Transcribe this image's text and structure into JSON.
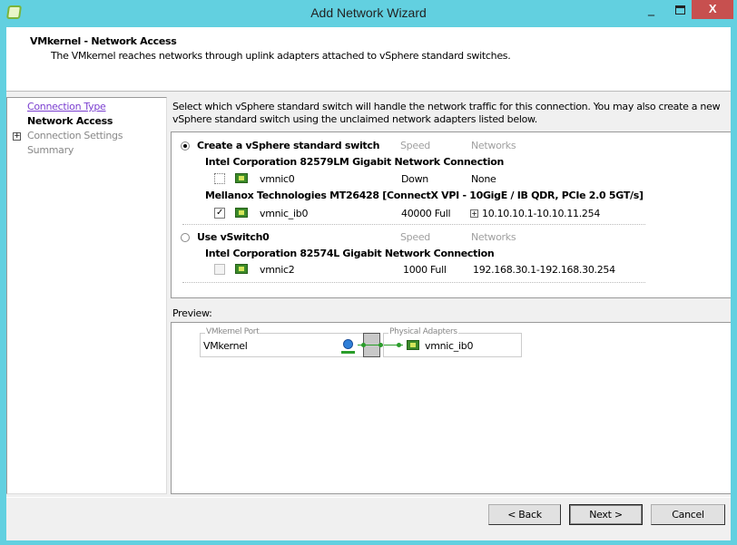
{
  "window": {
    "title": "Add Network Wizard",
    "minimize": "_",
    "close": "X"
  },
  "header": {
    "title": "VMkernel - Network Access",
    "subtitle": "The VMkernel reaches networks through uplink adapters attached to vSphere standard switches."
  },
  "nav": {
    "items": [
      {
        "label": "Connection Type"
      },
      {
        "label": "Network Access"
      },
      {
        "label": "Connection Settings"
      },
      {
        "label": "Summary"
      }
    ],
    "expand": "+"
  },
  "instruction": "Select which vSphere standard switch will handle the network traffic for this connection. You may also create a new vSphere standard switch using the unclaimed network adapters listed below.",
  "options": {
    "create": {
      "label": "Create a vSphere standard switch",
      "speed_header": "Speed",
      "networks_header": "Networks",
      "groups": [
        {
          "name": "Intel Corporation 82579LM Gigabit Network Connection",
          "adapter": {
            "name": "vmnic0",
            "speed": "Down",
            "networks": "None",
            "checked": false
          }
        },
        {
          "name": "Mellanox Technologies MT26428 [ConnectX VPI - 10GigE / IB QDR, PCIe 2.0 5GT/s]",
          "adapter": {
            "name": "vmnic_ib0",
            "speed": "40000 Full",
            "networks": "10.10.10.1-10.10.11.254",
            "checked": true,
            "check": "✓",
            "expand": "+"
          }
        }
      ]
    },
    "existing": {
      "label": "Use vSwitch0",
      "speed_header": "Speed",
      "networks_header": "Networks",
      "groups": [
        {
          "name": "Intel Corporation 82574L Gigabit Network Connection",
          "adapter": {
            "name": "vmnic2",
            "speed": "1000 Full",
            "networks": "192.168.30.1-192.168.30.254",
            "checked": false
          }
        }
      ]
    }
  },
  "preview": {
    "label": "Preview:",
    "port_legend": "VMkernel Port",
    "port_name": "VMkernel",
    "adapters_legend": "Physical Adapters",
    "adapter": "vmnic_ib0"
  },
  "buttons": {
    "back": "< Back",
    "next": "Next >",
    "cancel": "Cancel"
  }
}
